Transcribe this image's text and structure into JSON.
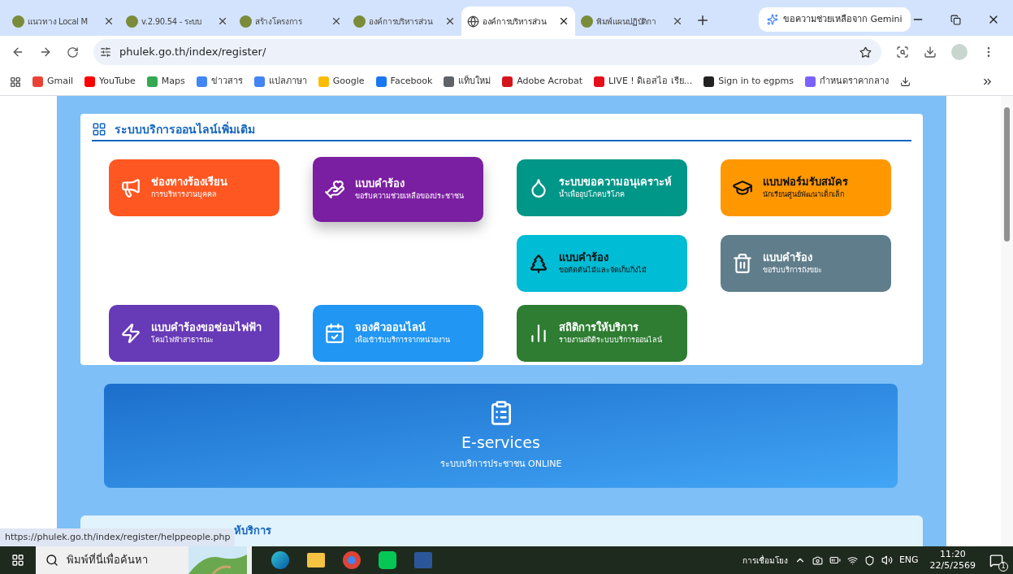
{
  "browser": {
    "tabs": [
      {
        "title": "แนวทาง Local M",
        "selected": false
      },
      {
        "title": "v.2.90.54 - ระบบ",
        "selected": false
      },
      {
        "title": "สร้างโครงการ",
        "selected": false
      },
      {
        "title": "องค์การบริหารส่วน",
        "selected": false
      },
      {
        "title": "องค์การบริหารส่วน",
        "selected": true
      },
      {
        "title": "พิมพ์แผนปฏิบัติกา",
        "selected": false
      }
    ],
    "gemini_button": "ขอความช่วยเหลือจาก Gemini",
    "address": "phulek.go.th/index/register/",
    "bookmarks": [
      {
        "label": "Gmail",
        "color": "#ea4335"
      },
      {
        "label": "YouTube",
        "color": "#ff0000"
      },
      {
        "label": "Maps",
        "color": "#34a853"
      },
      {
        "label": "ข่าวสาร",
        "color": "#4285f4"
      },
      {
        "label": "แปลภาษา",
        "color": "#4285f4"
      },
      {
        "label": "Google",
        "color": "#fbbc05"
      },
      {
        "label": "Facebook",
        "color": "#1877f2"
      },
      {
        "label": "แท็บใหม่",
        "color": "#5f6368"
      },
      {
        "label": "Adobe Acrobat",
        "color": "#d4151b"
      },
      {
        "label": "LIVE ! ดิเอสไอ เรีย...",
        "color": "#e4101a"
      },
      {
        "label": "Sign in to egpms",
        "color": "#222222"
      },
      {
        "label": "กำหนดราคากลาง",
        "color": "#7b61ff"
      }
    ],
    "status_url": "https://phulek.go.th/index/register/helppeople.php"
  },
  "section": {
    "title": "ระบบบริการออนไลน์เพิ่มเติม",
    "cards": [
      {
        "title": "ช่องทางร้องเรียน",
        "subtitle": "การบริหารงานบุคคล",
        "color": "#ff5722",
        "dark_text": false,
        "raised": false
      },
      {
        "title": "แบบคำร้อง",
        "subtitle": "ขอรับความช่วยเหลือของประชาชน",
        "color": "#7b1fa2",
        "dark_text": false,
        "raised": true
      },
      {
        "title": "ระบบขอความอนุเคราะห์",
        "subtitle": "น้ำเพื่ออุปโภคบริโภค",
        "color": "#009688",
        "dark_text": false,
        "raised": false
      },
      {
        "title": "แบบฟอร์มรับสมัคร",
        "subtitle": "นักเรียนศูนย์พัฒนาเด็กเล็ก",
        "color": "#ff9800",
        "dark_text": true,
        "raised": false
      },
      {
        "title": "แบบคำร้อง",
        "subtitle": "ขอตัดต้นไม้และจัดเก็บกิ่งไม้",
        "color": "#00bcd4",
        "dark_text": true,
        "raised": false
      },
      {
        "title": "แบบคำร้อง",
        "subtitle": "ขอรับบริการถังขยะ",
        "color": "#607d8b",
        "dark_text": false,
        "raised": false
      },
      {
        "title": "แบบคำร้องขอซ่อมไฟฟ้า",
        "subtitle": "โคมไฟฟ้าสาธารณะ",
        "color": "#673ab7",
        "dark_text": false,
        "raised": false
      },
      {
        "title": "จองคิวออนไลน์",
        "subtitle": "เพื่อเข้ารับบริการจากหน่วยงาน",
        "color": "#2196f3",
        "dark_text": false,
        "raised": false
      },
      {
        "title": "สถิติการให้บริการ",
        "subtitle": "รายงานสถิติระบบบริการออนไลน์",
        "color": "#2e7d32",
        "dark_text": false,
        "raised": false
      }
    ]
  },
  "banner": {
    "title": "E-services",
    "subtitle": "ระบบบริการประชาชน ONLINE"
  },
  "next_section": {
    "title": "ห้บริการ"
  },
  "taskbar": {
    "search_placeholder": "พิมพ์ที่นี่เพื่อค้นหา",
    "network_label": "การเชื่อมโยง",
    "language": "ENG",
    "time": "11:20",
    "date": "22/5/2569",
    "notifications": "1"
  }
}
